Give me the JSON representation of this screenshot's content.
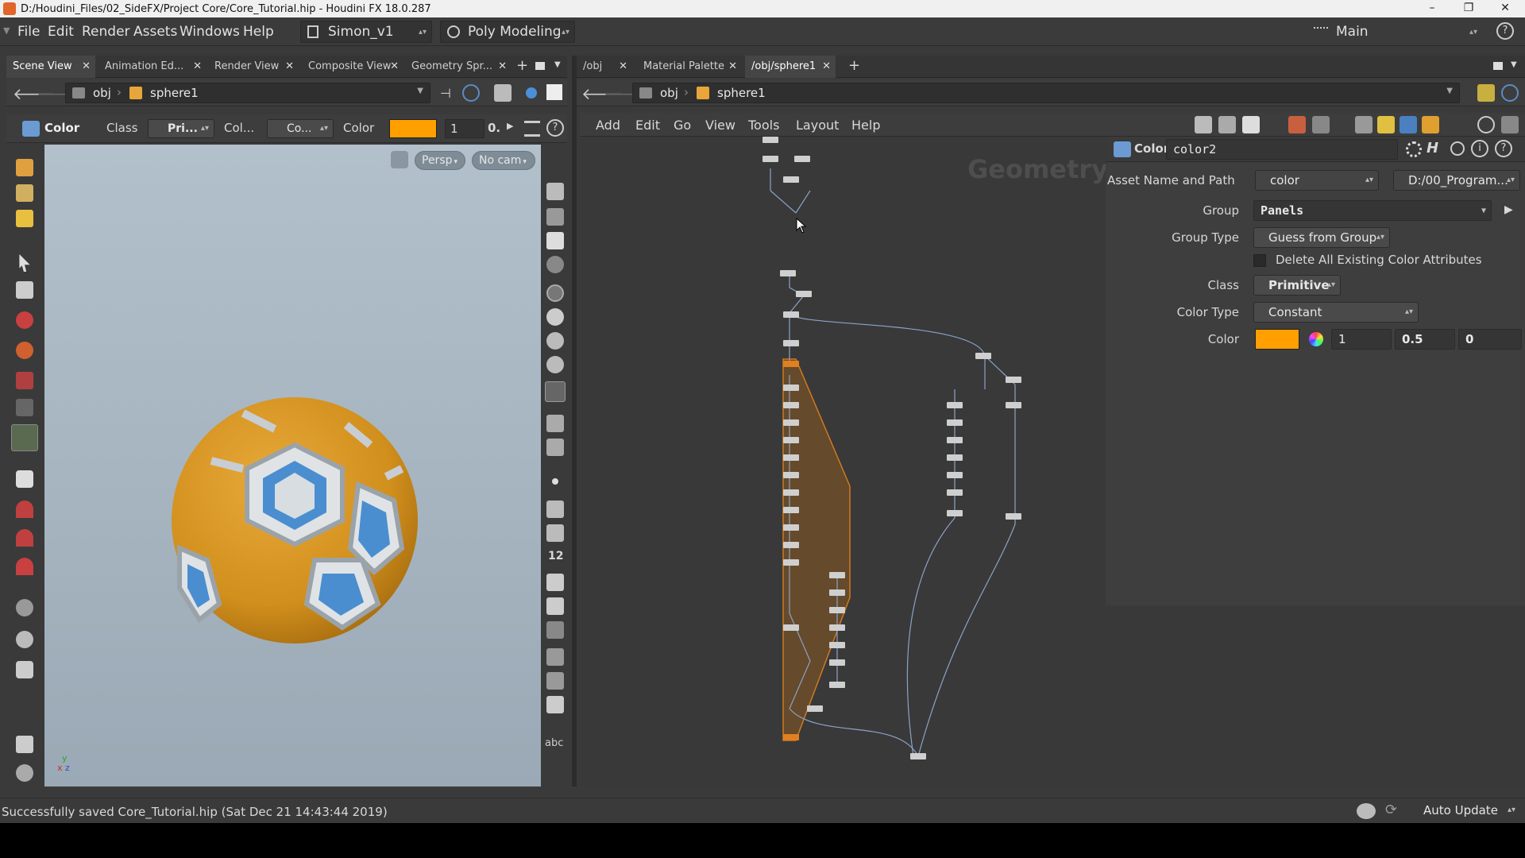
{
  "window": {
    "title": "D:/Houdini_Files/02_SideFX/Project Core/Core_Tutorial.hip - Houdini FX 18.0.287",
    "controls": [
      "–",
      "❐",
      "✕"
    ]
  },
  "menubar": {
    "items": [
      "File",
      "Edit",
      "Render",
      "Assets",
      "Windows",
      "Help"
    ],
    "desktop": "Simon_v1",
    "shelf_set": "Poly Modeling",
    "main": "Main"
  },
  "left_pane": {
    "tabs": [
      "Scene View",
      "Animation Ed...",
      "Render View",
      "Composite View",
      "Geometry Spr..."
    ],
    "path": {
      "root": "obj",
      "node": "sphere1"
    },
    "toolbar": {
      "tool": "Color",
      "class_label": "Class",
      "class_value": "Pri...",
      "col_label": "Col...",
      "co_value": "Co...",
      "color_label": "Color",
      "color_hex": "#ff9f00",
      "r": "1",
      "g": "0."
    },
    "viewport": {
      "persp": "Persp",
      "cam": "No cam"
    }
  },
  "right_pane": {
    "tabs": [
      "/obj",
      "Material Palette",
      "/obj/sphere1"
    ],
    "path": {
      "root": "obj",
      "node": "sphere1"
    },
    "network_menu": [
      "Add",
      "Edit",
      "Go",
      "View",
      "Tools",
      "Layout",
      "Help"
    ],
    "network_watermark": "Geometry"
  },
  "params": {
    "node_type": "Color",
    "node_name": "color2",
    "asset_label": "Asset Name and Path",
    "asset_name": "color",
    "asset_path": "D:/00_Program...",
    "group_label": "Group",
    "group_value": "Panels",
    "group_type_label": "Group Type",
    "group_type_value": "Guess from Group",
    "delete_label": "Delete All Existing Color Attributes",
    "class_label": "Class",
    "class_value": "Primitive",
    "color_type_label": "Color Type",
    "color_type_value": "Constant",
    "color_label": "Color",
    "color_hex": "#ff9f00",
    "r": "1",
    "g": "0.5",
    "b": "0"
  },
  "status": {
    "message": "Successfully saved Core_Tutorial.hip (Sat Dec 21 14:43:44 2019)",
    "update_mode": "Auto Update"
  },
  "icons": {
    "viewport_text": "abc"
  }
}
